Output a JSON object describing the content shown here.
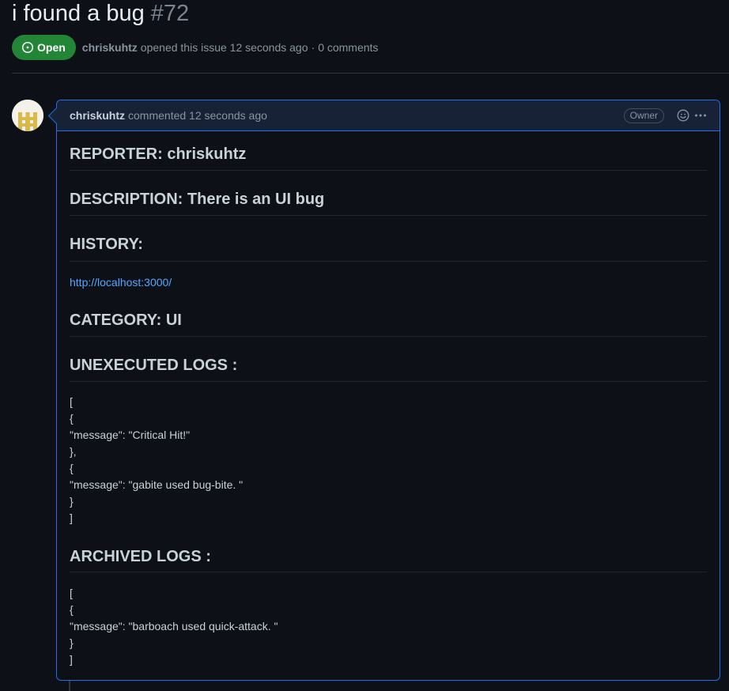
{
  "issue": {
    "title": "i found a bug",
    "number": "#72",
    "state": "Open",
    "author": "chriskuhtz",
    "opened_text": "opened this issue 12 seconds ago",
    "separator": "·",
    "comments_count": "0 comments"
  },
  "comment": {
    "author": "chriskuhtz",
    "action_text": "commented 12 seconds ago",
    "role_badge": "Owner",
    "headings": {
      "reporter": "REPORTER: chriskuhtz",
      "description": "DESCRIPTION: There is an UI bug",
      "history": "HISTORY:",
      "category": "CATEGORY: UI",
      "unexecuted_logs": "UNEXECUTED LOGS :",
      "archived_logs": "ARCHIVED LOGS :"
    },
    "history_link": "http://localhost:3000/",
    "unexecuted_lines": [
      "[",
      "{",
      "\"message\": \"Critical Hit!\"",
      "},",
      "{",
      "\"message\": \"gabite used bug-bite. \"",
      "}",
      "]"
    ],
    "archived_lines": [
      "[",
      "{",
      "\"message\": \"barboach used quick-attack. \"",
      "}",
      "]"
    ]
  },
  "icons": {
    "state": "issue-opened-icon",
    "reaction": "smiley-icon",
    "more": "kebab-horizontal-icon"
  },
  "colors": {
    "background": "#0d1117",
    "open_badge": "#238636",
    "link": "#58a6ff",
    "comment_border": "#1f6feb",
    "comment_header": "#172237"
  }
}
